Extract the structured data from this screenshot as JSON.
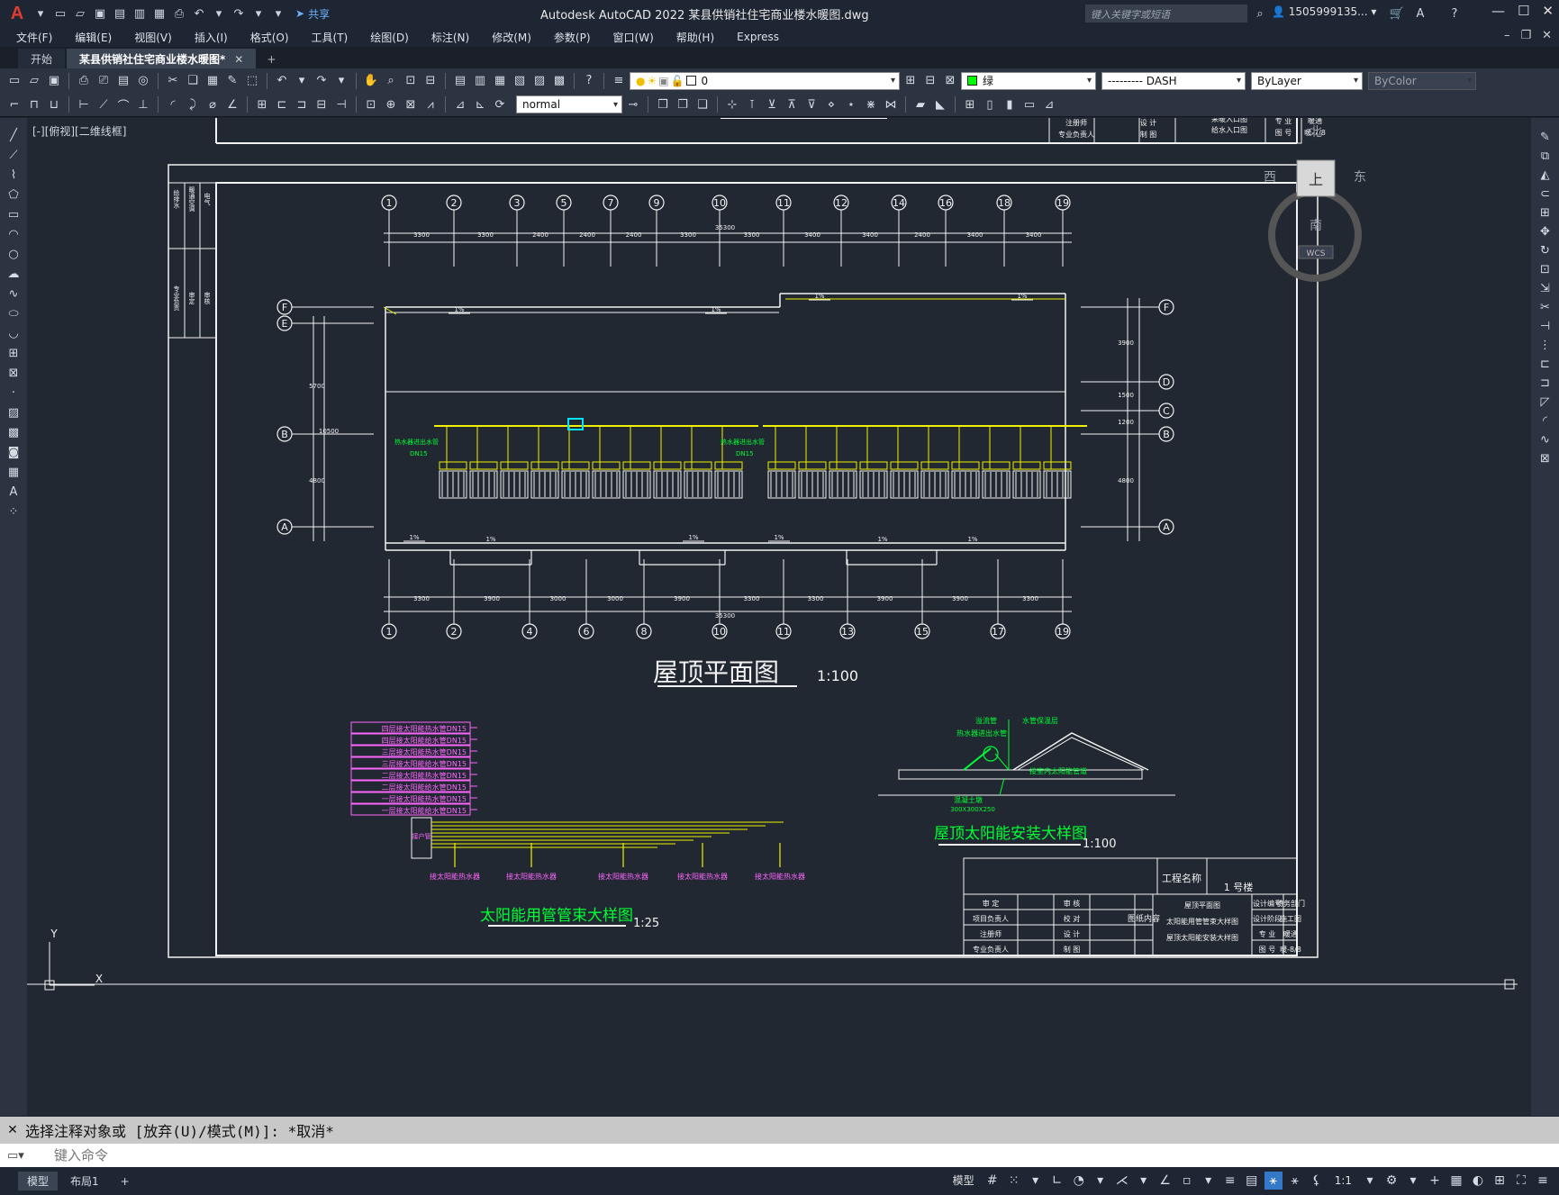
{
  "app": {
    "title": "Autodesk AutoCAD 2022    某县供销社住宅商业楼水暖图.dwg",
    "share_label": "共享",
    "search_placeholder": "键入关键字或短语",
    "user_name": "1505999135...",
    "logo_letter": "A"
  },
  "menu": [
    "文件(F)",
    "编辑(E)",
    "视图(V)",
    "插入(I)",
    "格式(O)",
    "工具(T)",
    "绘图(D)",
    "标注(N)",
    "修改(M)",
    "参数(P)",
    "窗口(W)",
    "帮助(H)",
    "Express"
  ],
  "tabs": [
    {
      "label": "开始",
      "active": false
    },
    {
      "label": "某县供销社住宅商业楼水暖图*",
      "active": true
    }
  ],
  "toolbar": {
    "layer_value": "0",
    "color_value": "绿",
    "color_hex": "#00ff00",
    "linetype_value": "--------- DASH",
    "lineweight_value": "ByLayer",
    "plotstyle_value": "ByColor",
    "textstyle_value": "normal"
  },
  "viewport_label": "[-][俯视][二维线框]",
  "viewcube": {
    "north": "北",
    "south": "南",
    "east": "东",
    "west": "西",
    "face": "上",
    "wcs": "WCS"
  },
  "drawing": {
    "roof_plan_title": "屋顶平面图",
    "roof_plan_scale": "1:100",
    "solar_detail_title": "屋顶太阳能安装大样图",
    "solar_detail_scale": "1:100",
    "pipe_detail_title": "太阳能用管管束大样图",
    "pipe_detail_scale": "1:25",
    "top_partial_scale": "1:100",
    "total_dim": "35300",
    "top_axes": [
      "1",
      "2",
      "3",
      "5",
      "7",
      "9",
      "10",
      "11",
      "12",
      "14",
      "16",
      "18",
      "19"
    ],
    "bottom_axes": [
      "1",
      "2",
      "4",
      "6",
      "8",
      "10",
      "11",
      "13",
      "15",
      "17",
      "19"
    ],
    "top_spans": [
      "3300",
      "3300",
      "2400",
      "2400",
      "2400",
      "3300",
      "3300",
      "3400",
      "3400",
      "2400",
      "3400",
      "3400"
    ],
    "bottom_spans": [
      "3300",
      "3900",
      "3000",
      "3000",
      "3900",
      "3300",
      "3300",
      "3900",
      "3900",
      "3300"
    ],
    "left_axes": [
      "F",
      "E",
      "B",
      "A"
    ],
    "right_axes": [
      "F",
      "D",
      "C",
      "B",
      "A"
    ],
    "pipe_labels": [
      "四层接太阳能热水管DN15",
      "四层接太阳能给水管DN15",
      "三层接太阳能热水管DN15",
      "三层接太阳能给水管DN15",
      "二层接太阳能热水管DN15",
      "二层接太阳能给水管DN15",
      "一层接太阳能热水管DN15",
      "一层接太阳能给水管DN15"
    ],
    "heater_labels": [
      "接太阳能热水器",
      "接太阳能热水器",
      "接太阳能热水器",
      "接太阳能热水器",
      "接太阳能热水器"
    ],
    "plan_note": "热水器进出水管",
    "plan_note_dn": "DN15",
    "solar_notes": [
      "溢流管",
      "水管保温层",
      "热水器进出水管",
      "接室内太阳能管道",
      "混凝土墩",
      "300X300X250"
    ],
    "title_block": {
      "project_label": "工程名称",
      "project_value": "1 号楼",
      "rows_left": [
        [
          "审    定",
          "审 核"
        ],
        [
          "项目负责人",
          "校 对"
        ],
        [
          "注册师",
          "设 计"
        ],
        [
          "专业负责人",
          "制 图"
        ]
      ],
      "content_label": "图纸内容",
      "contents": [
        "屋顶平面图",
        "太阳能用管管束大样图",
        "屋顶太阳能安装大样图"
      ],
      "right_rows": [
        [
          "设计编号",
          "特务部门"
        ],
        [
          "设计阶段",
          "施工图"
        ],
        [
          "专 业",
          "暖通"
        ],
        [
          "图 号",
          "暖-8/8"
        ]
      ]
    },
    "top_block_rows": [
      [
        "注册师",
        "设 计"
      ],
      [
        "专业负责人",
        "制 图"
      ]
    ],
    "top_block_contents": [
      "太阳能热水管安装系统图",
      "采暖入口图",
      "给水入口图"
    ],
    "top_block_right": [
      [
        "专 业",
        "暖通"
      ],
      [
        "图 号",
        "暖-7/8"
      ]
    ],
    "left_strip_labels": [
      "给排水",
      "暖通空调",
      "电气",
      "专业负责",
      "审定",
      "审核"
    ]
  },
  "command": {
    "history": "选择注释对象或 [放弃(U)/模式(M)]: *取消*",
    "placeholder": "键入命令"
  },
  "status": {
    "layouts": [
      {
        "label": "模型",
        "active": true
      },
      {
        "label": "布局1",
        "active": false
      }
    ],
    "model_label": "模型",
    "scale": "1:1"
  }
}
